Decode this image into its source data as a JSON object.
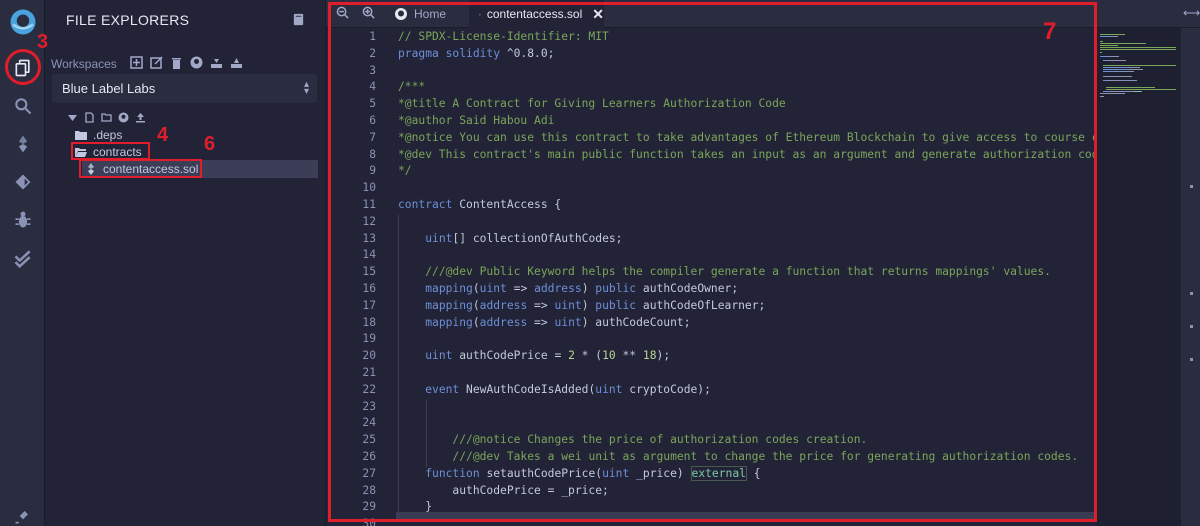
{
  "rail": {
    "icons": [
      "remix-logo-icon",
      "file-explorers-icon",
      "search-icon",
      "solidity-compiler-icon",
      "deploy-icon",
      "debugger-icon",
      "test-icon",
      "plugin-icon"
    ]
  },
  "panel": {
    "title": "FILE EXPLORERS",
    "workspaces_label": "Workspaces",
    "workspace_selected": "Blue Label Labs",
    "tree": [
      {
        "name": ".deps",
        "type": "folder"
      },
      {
        "name": "contracts",
        "type": "folder-open"
      },
      {
        "name": "contentaccess.sol",
        "type": "file"
      }
    ]
  },
  "annotations": [
    "3",
    "4",
    "6",
    "7"
  ],
  "editor": {
    "tabs": [
      {
        "label": "Home",
        "active": false
      },
      {
        "label": "contentaccess.sol",
        "active": true
      }
    ],
    "lines": [
      {
        "n": "1",
        "tokens": [
          [
            "c",
            "// SPDX-License-Identifier: MIT"
          ]
        ]
      },
      {
        "n": "2",
        "tokens": [
          [
            "k",
            "pragma solidity "
          ],
          [
            "i",
            "^0.8.0;"
          ]
        ]
      },
      {
        "n": "3",
        "tokens": []
      },
      {
        "n": "4",
        "tokens": [
          [
            "c",
            "/***"
          ]
        ]
      },
      {
        "n": "5",
        "tokens": [
          [
            "c",
            "*@title A Contract for Giving Learners Authorization Code"
          ]
        ]
      },
      {
        "n": "6",
        "tokens": [
          [
            "c",
            "*@author Said Habou Adi"
          ]
        ]
      },
      {
        "n": "7",
        "tokens": [
          [
            "c",
            "*@notice You can use this contract to take advantages of Ethereum Blockchain to give access to course c"
          ]
        ]
      },
      {
        "n": "8",
        "tokens": [
          [
            "c",
            "*@dev This contract's main public function takes an input as an argument and generate authorization code"
          ]
        ]
      },
      {
        "n": "9",
        "tokens": [
          [
            "c",
            "*/"
          ]
        ]
      },
      {
        "n": "10",
        "tokens": []
      },
      {
        "n": "11",
        "tokens": [
          [
            "k",
            "contract "
          ],
          [
            "i",
            "ContentAccess {"
          ]
        ]
      },
      {
        "n": "12",
        "tokens": []
      },
      {
        "n": "13",
        "tokens": [
          [
            "i",
            "    "
          ],
          [
            "k",
            "uint"
          ],
          [
            "i",
            "[] collectionOfAuthCodes;"
          ]
        ]
      },
      {
        "n": "14",
        "tokens": []
      },
      {
        "n": "15",
        "tokens": [
          [
            "i",
            "    "
          ],
          [
            "c",
            "///@dev Public Keyword helps the compiler generate a function that returns mappings' values."
          ]
        ]
      },
      {
        "n": "16",
        "tokens": [
          [
            "i",
            "    "
          ],
          [
            "k",
            "mapping"
          ],
          [
            "i",
            "("
          ],
          [
            "k",
            "uint"
          ],
          [
            "i",
            " => "
          ],
          [
            "k",
            "address"
          ],
          [
            "i",
            ") "
          ],
          [
            "k",
            "public"
          ],
          [
            "i",
            " authCodeOwner;"
          ]
        ]
      },
      {
        "n": "17",
        "tokens": [
          [
            "i",
            "    "
          ],
          [
            "k",
            "mapping"
          ],
          [
            "i",
            "("
          ],
          [
            "k",
            "address"
          ],
          [
            "i",
            " => "
          ],
          [
            "k",
            "uint"
          ],
          [
            "i",
            ") "
          ],
          [
            "k",
            "public"
          ],
          [
            "i",
            " authCodeOfLearner;"
          ]
        ]
      },
      {
        "n": "18",
        "tokens": [
          [
            "i",
            "    "
          ],
          [
            "k",
            "mapping"
          ],
          [
            "i",
            "("
          ],
          [
            "k",
            "address"
          ],
          [
            "i",
            " => "
          ],
          [
            "k",
            "uint"
          ],
          [
            "i",
            ") authCodeCount;"
          ]
        ]
      },
      {
        "n": "19",
        "tokens": []
      },
      {
        "n": "20",
        "tokens": [
          [
            "i",
            "    "
          ],
          [
            "k",
            "uint"
          ],
          [
            "i",
            " authCodePrice = "
          ],
          [
            "x",
            "2"
          ],
          [
            "i",
            " * ("
          ],
          [
            "x",
            "10"
          ],
          [
            "i",
            " ** "
          ],
          [
            "x",
            "18"
          ],
          [
            "i",
            ");"
          ]
        ]
      },
      {
        "n": "21",
        "tokens": []
      },
      {
        "n": "22",
        "tokens": [
          [
            "i",
            "    "
          ],
          [
            "k",
            "event"
          ],
          [
            "i",
            " NewAuthCodeIsAdded("
          ],
          [
            "k",
            "uint"
          ],
          [
            "i",
            " cryptoCode);"
          ]
        ]
      },
      {
        "n": "23",
        "tokens": []
      },
      {
        "n": "24",
        "tokens": []
      },
      {
        "n": "25",
        "tokens": [
          [
            "i",
            "        "
          ],
          [
            "c",
            "///@notice Changes the price of authorization codes creation."
          ]
        ]
      },
      {
        "n": "26",
        "tokens": [
          [
            "i",
            "        "
          ],
          [
            "c",
            "///@dev Takes a wei unit as argument to change the price for generating authorization codes."
          ]
        ]
      },
      {
        "n": "27",
        "tokens": [
          [
            "i",
            "    "
          ],
          [
            "k",
            "function"
          ],
          [
            "i",
            " setauthCodePrice("
          ],
          [
            "k",
            "uint"
          ],
          [
            "i",
            " _price) "
          ],
          [
            "e",
            "external"
          ],
          [
            "i",
            " {"
          ]
        ]
      },
      {
        "n": "28",
        "tokens": [
          [
            "i",
            "        authCodePrice = _price;"
          ]
        ]
      },
      {
        "n": "29",
        "tokens": [
          [
            "i",
            "    }"
          ]
        ]
      },
      {
        "n": "30",
        "tokens": []
      }
    ]
  },
  "colors": {
    "background": "#222336",
    "annotation_red": "#e01e2b",
    "comment": "#7aa65a",
    "keyword": "#6d8fd6"
  }
}
